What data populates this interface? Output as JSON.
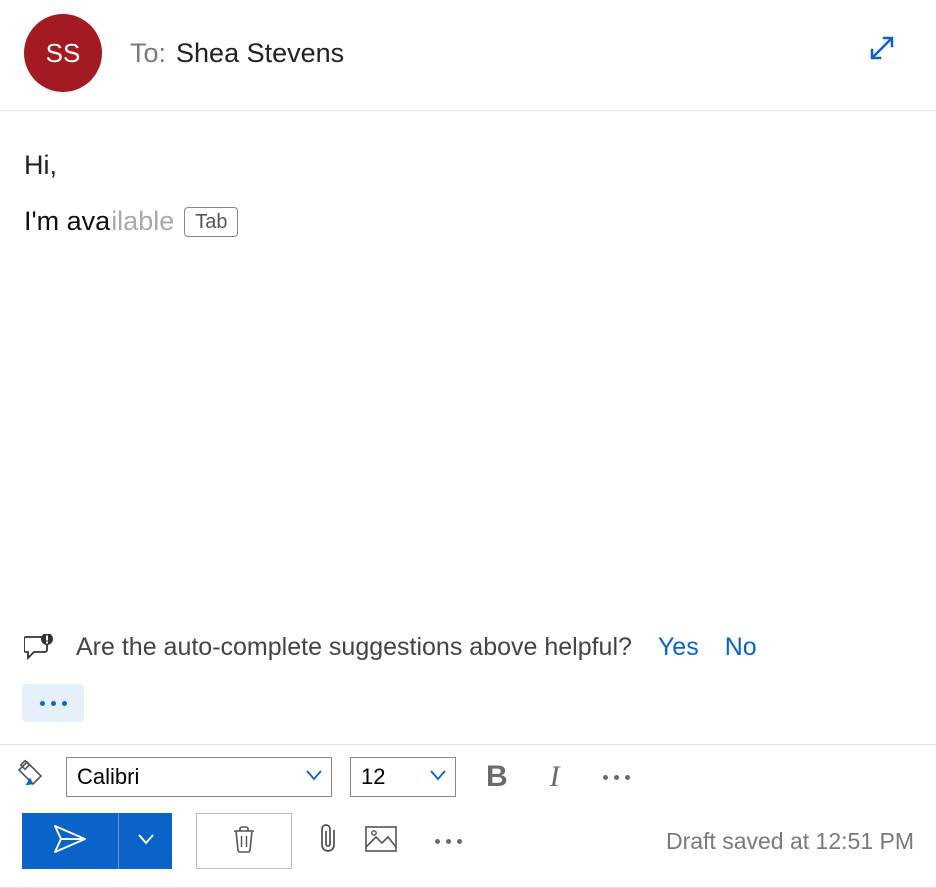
{
  "header": {
    "avatar_initials": "SS",
    "to_label": "To:",
    "recipient_name": "Shea Stevens"
  },
  "body": {
    "greeting": "Hi,",
    "typed_text": "I'm ava",
    "suggestion_text": "ilable",
    "tab_hint": "Tab"
  },
  "feedback": {
    "question": "Are the auto-complete suggestions above helpful?",
    "yes": "Yes",
    "no": "No"
  },
  "format_toolbar": {
    "font_name": "Calibri",
    "font_size": "12",
    "bold_label": "B",
    "italic_label": "I"
  },
  "status": {
    "draft_saved": "Draft saved at 12:51 PM"
  }
}
